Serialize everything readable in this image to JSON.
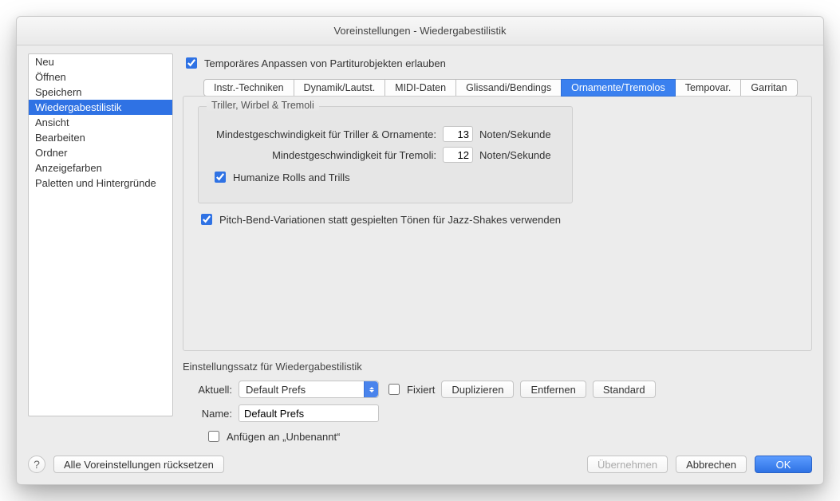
{
  "window": {
    "title": "Voreinstellungen - Wiedergabestilistik"
  },
  "sidebar": {
    "items": [
      "Neu",
      "Öffnen",
      "Speichern",
      "Wiedergabestilistik",
      "Ansicht",
      "Bearbeiten",
      "Ordner",
      "Anzeigefarben",
      "Paletten und Hintergründe"
    ],
    "selected": "Wiedergabestilistik"
  },
  "main": {
    "temp_adjust": "Temporäres Anpassen von Partiturobjekten erlauben",
    "tabs": [
      "Instr.-Techniken",
      "Dynamik/Lautst.",
      "MIDI-Daten",
      "Glissandi/Bendings",
      "Ornamente/Tremolos",
      "Tempovar.",
      "Garritan"
    ],
    "selected_tab": "Ornamente/Tremolos",
    "group": {
      "title": "Triller, Wirbel & Tremoli",
      "row1_label": "Mindestgeschwindigkeit für Triller & Ornamente:",
      "row1_value": "13",
      "row2_label": "Mindestgeschwindigkeit für Tremoli:",
      "row2_value": "12",
      "unit": "Noten/Sekunde",
      "humanize": "Humanize Rolls and Trills"
    },
    "pitchbend": "Pitch-Bend-Variationen statt gespielten Tönen für Jazz-Shakes verwenden"
  },
  "preset": {
    "section_title": "Einstellungssatz für Wiedergabestilistik",
    "current_label": "Aktuell:",
    "current_value": "Default Prefs",
    "fixed": "Fixiert",
    "dup": "Duplizieren",
    "remove": "Entfernen",
    "standard": "Standard",
    "name_label": "Name:",
    "name_value": "Default Prefs",
    "attach": "Anfügen an „Unbenannt“"
  },
  "footer": {
    "reset": "Alle Voreinstellungen rücksetzen",
    "apply": "Übernehmen",
    "cancel": "Abbrechen",
    "ok": "OK"
  }
}
